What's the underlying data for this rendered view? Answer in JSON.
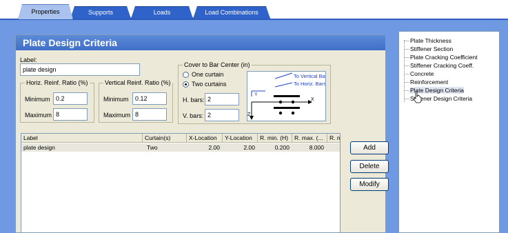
{
  "tabs": [
    {
      "label": "Properties",
      "active": true
    },
    {
      "label": "Supports",
      "active": false
    },
    {
      "label": "Loads",
      "active": false
    },
    {
      "label": "Load Combinations",
      "active": false
    }
  ],
  "panel": {
    "title": "Plate Design Criteria",
    "label_caption": "Label:",
    "label_value": "plate design"
  },
  "horiz": {
    "title": "Horiz. Reinf. Ratio (%)",
    "min_label": "Minimum",
    "min_value": "0.2",
    "max_label": "Maximum",
    "max_value": "8"
  },
  "vert": {
    "title": "Vertical Reinf. Ratio (%)",
    "min_label": "Minimum",
    "min_value": "0.12",
    "max_label": "Maximum",
    "max_value": "8"
  },
  "cover": {
    "title": "Cover to Bar Center (in)",
    "one_curtain": "One curtain",
    "two_curtains": "Two curtains",
    "selected": "Two curtains",
    "hbars_label": "H. bars:",
    "hbars_value": "2",
    "vbars_label": "V. bars:",
    "vbars_value": "2"
  },
  "diagram": {
    "to_vertical": "To Vertical Bars",
    "to_horiz": "To Horiz. Bars",
    "x_axis": "X",
    "z_axis": "Z"
  },
  "table": {
    "headers": [
      "Label",
      "Curtain(s)",
      "X-Location",
      "Y-Location",
      "R. min. (H)",
      "R. max. (...",
      "R. n"
    ],
    "rows": [
      [
        "plate design",
        "Two",
        "2.00",
        "2.00",
        "0.200",
        "8.000",
        ""
      ]
    ]
  },
  "buttons": {
    "add": "Add",
    "delete": "Delete",
    "modify": "Modify"
  },
  "tree": {
    "items": [
      "Plate Thickness",
      "Stiffener Section",
      "Plate Cracking Coefficient",
      "Stiffener Cracking Coeff.",
      "Concrete",
      "Reinforcement",
      "Plate Design Criteria",
      "Stiffener Design Criteria"
    ],
    "selected": "Plate Design Criteria"
  },
  "colors": {
    "band": "#6f99e2",
    "tab_inactive": "#2f63c9",
    "tab_active": "#a9c3ee",
    "title_bar": "#3f6fc7",
    "diagram_blue": "#1f3fcc"
  }
}
